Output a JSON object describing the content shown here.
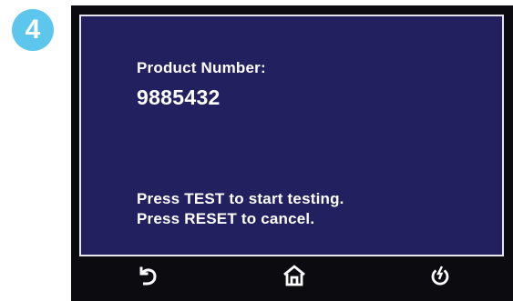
{
  "step": {
    "number": "4"
  },
  "screen": {
    "label": "Product Number:",
    "value": "9885432",
    "instructions": [
      "Press TEST to start testing.",
      "Press RESET to cancel."
    ]
  },
  "softkeys": [
    {
      "icon": "back-arrow-icon"
    },
    {
      "icon": "home-icon"
    },
    {
      "icon": "power-icon"
    }
  ],
  "colors": {
    "badge": "#5cc6ec",
    "screen_bg": "#22205e",
    "bezel": "#0c0c10",
    "text": "#ffffff"
  }
}
